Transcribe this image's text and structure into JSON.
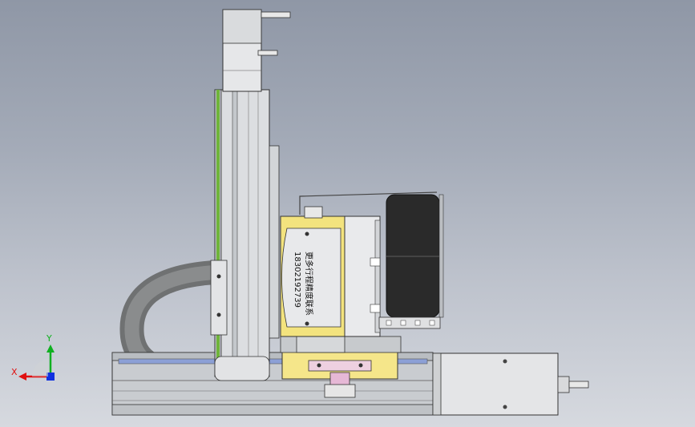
{
  "viewport": {
    "background_top": "#8f97a6",
    "background_bottom": "#d6d9df"
  },
  "model_label": {
    "line1": "更多行程精度联系",
    "line2": "18302192739"
  },
  "triad": {
    "x_label": "X",
    "y_label": "Y",
    "x_color": "#e01010",
    "y_color": "#10b020",
    "z_color": "#1030e0"
  },
  "colors": {
    "aluminum": "#d9dbde",
    "aluminum_dark": "#9da2a8",
    "yellow_plate": "#f5e68a",
    "black_wheel": "#2a2a2a",
    "cable_chain": "#7d7f80",
    "pink_block": "#e6b8d6",
    "green_strip": "#6fb43a"
  }
}
